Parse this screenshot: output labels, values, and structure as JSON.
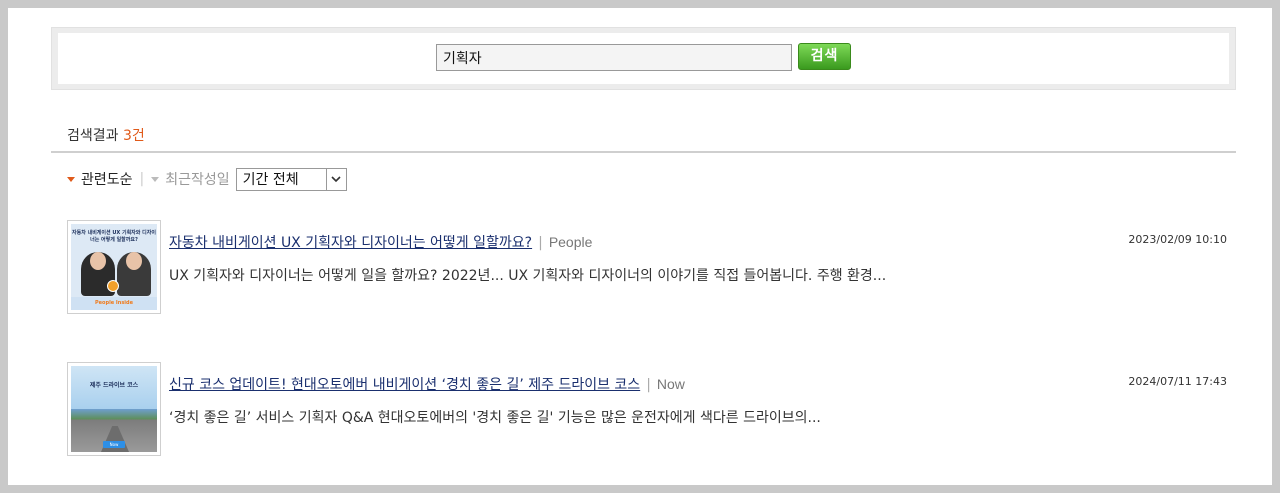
{
  "search": {
    "query": "기획자",
    "button_label": "검색"
  },
  "results_header": {
    "label": "검색결과",
    "count": "3건"
  },
  "sort": {
    "active": "관련도순",
    "inactive": "최근작성일",
    "period_selected": "기간 전체"
  },
  "results": [
    {
      "title": "자동차 내비게이션 UX 기획자와 디자이너는 어떻게 일할까요?",
      "category": "People",
      "date": "2023/02/09 10:10",
      "description": "UX 기획자와 디자이너는 어떻게 일을 할까요? 2022년... UX 기획자와 디자이너의 이야기를 직접 들어봅니다. 주행 환경...",
      "thumbnail": {
        "caption": "자동차 내비게이션 UX 기획자와 디자이너는 어떻게 일할까요?",
        "footer": "People Inside"
      }
    },
    {
      "title": "신규 코스 업데이트! 현대오토에버 내비게이션 ‘경치 좋은 길’ 제주 드라이브 코스",
      "category": "Now",
      "date": "2024/07/11 17:43",
      "description": "‘경치 좋은 길’ 서비스 기획자 Q&A 현대오토에버의 '경치 좋은 길' 기능은 많은 운전자에게 색다른 드라이브의...",
      "thumbnail": {
        "caption": "제주 드라이브 코스",
        "badge": "Now"
      }
    }
  ],
  "colors": {
    "accent_orange": "#e05a1a",
    "button_green": "#4caf2a",
    "link_navy": "#1a2f6e"
  }
}
